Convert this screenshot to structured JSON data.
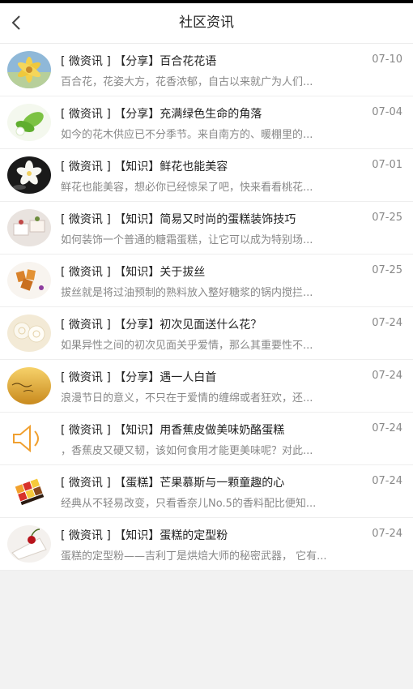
{
  "header": {
    "title": "社区资讯"
  },
  "items": [
    {
      "headline": "[ 微资讯 ] 【分享】百合花花语",
      "date": "07-10",
      "summary": "百合花，花姿大方，花香浓郁，自古以来就广为人们..."
    },
    {
      "headline": "[ 微资讯 ] 【分享】充满绿色生命的角落",
      "date": "07-04",
      "summary": "如今的花木供应已不分季节。来自南方的、暖棚里的..."
    },
    {
      "headline": "[ 微资讯 ] 【知识】鲜花也能美容",
      "date": "07-01",
      "summary": "鲜花也能美容，想必你已经惊呆了吧，快来看看桃花..."
    },
    {
      "headline": "[ 微资讯 ] 【知识】简易又时尚的蛋糕装饰技巧",
      "date": "07-25",
      "summary": "如何装饰一个普通的糖霜蛋糕，让它可以成为特别场..."
    },
    {
      "headline": "[ 微资讯 ] 【知识】关于拔丝",
      "date": "07-25",
      "summary": "拔丝就是将过油预制的熟料放入整好糖浆的锅内搅拦..."
    },
    {
      "headline": "[ 微资讯 ] 【分享】初次见面送什么花？",
      "date": "07-24",
      "summary": "如果异性之间的初次见面关乎爱情，那么其重要性不..."
    },
    {
      "headline": "[ 微资讯 ] 【分享】遇一人白首",
      "date": "07-24",
      "summary": "浪漫节日的意义，不只在于爱情的缠绵或者狂欢，还..."
    },
    {
      "headline": "[ 微资讯 ] 【知识】用香蕉皮做美味奶酪蛋糕",
      "date": "07-24",
      "summary": "，香蕉皮又硬又韧，该如何食用才能更美味呢？对此..."
    },
    {
      "headline": "[ 微资讯 ] 【蛋糕】芒果慕斯与一颗童趣的心",
      "date": "07-24",
      "summary": "经典从不轻易改变，只看香奈儿No.5的香料配比便知..."
    },
    {
      "headline": "[ 微资讯 ] 【知识】蛋糕的定型粉",
      "date": "07-24",
      "summary": "蛋糕的定型粉——吉利丁是烘焙大师的秘密武器， 它有..."
    }
  ]
}
